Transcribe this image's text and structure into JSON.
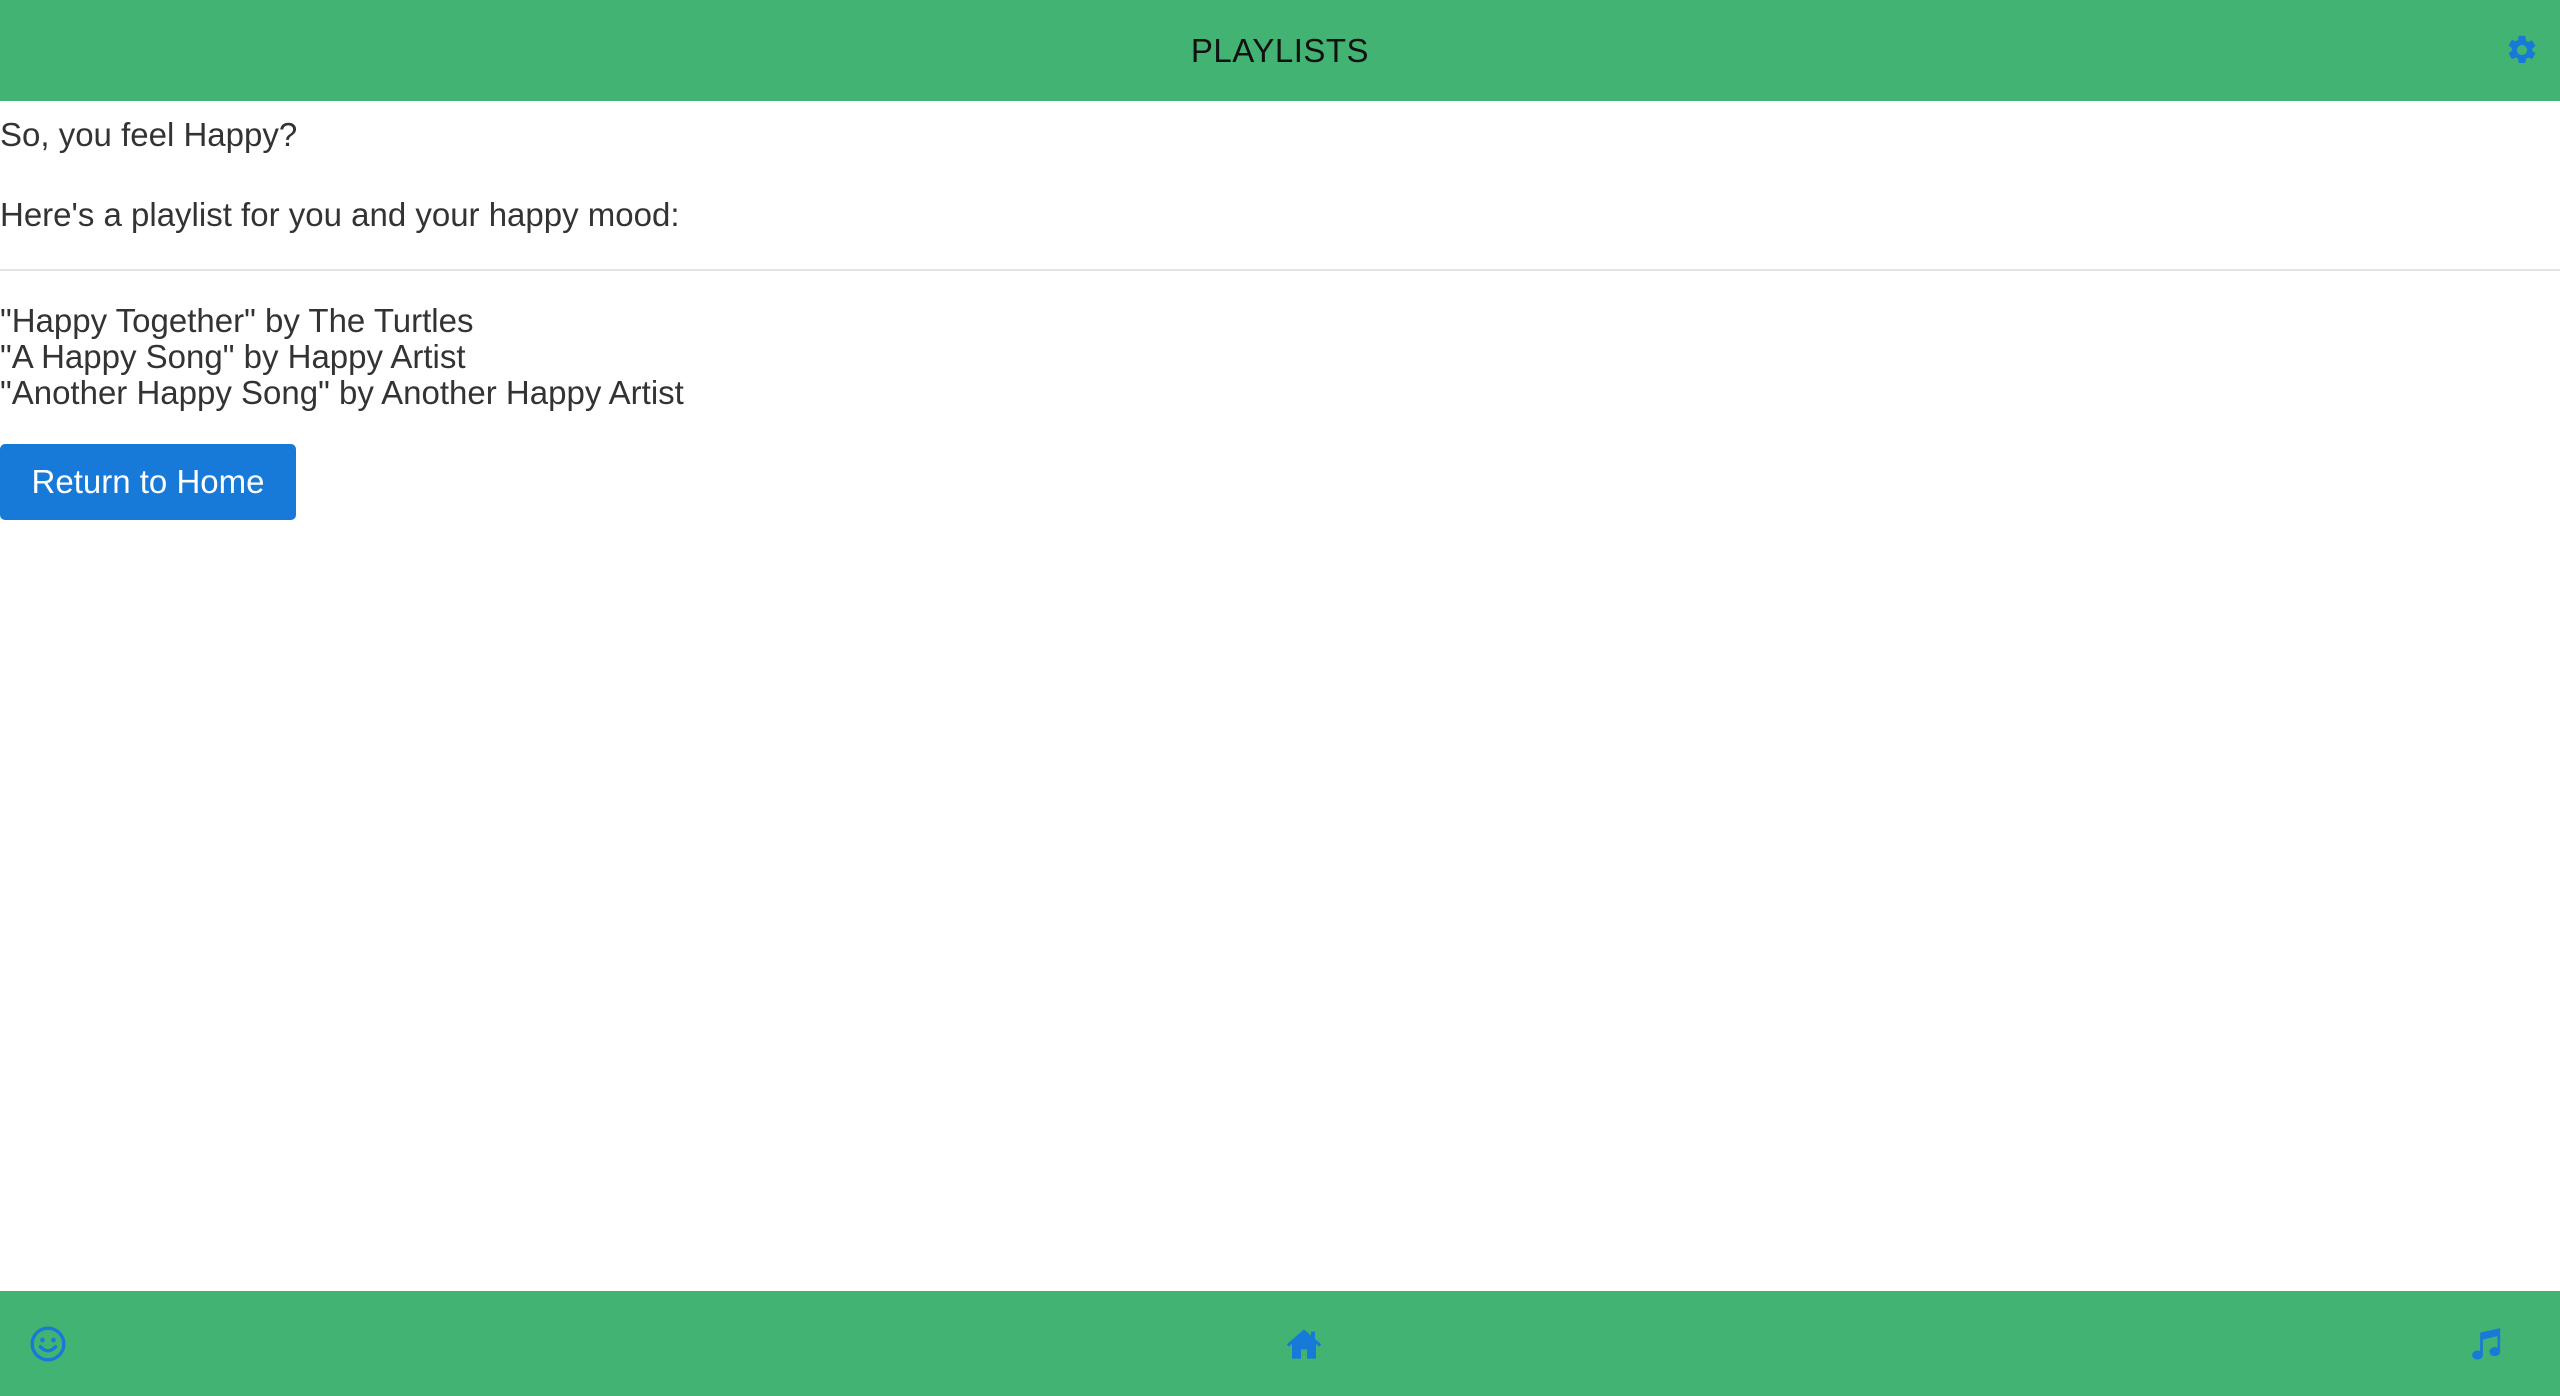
{
  "header": {
    "title": "PLAYLISTS",
    "settings_icon": "gear-icon"
  },
  "main": {
    "question": "So, you feel Happy?",
    "intro": "Here's a playlist for you and your happy mood:",
    "songs": [
      "\"Happy Together\" by The Turtles",
      "\"A Happy Song\" by Happy Artist",
      "\"Another Happy Song\" by Another Happy Artist"
    ],
    "return_button": "Return to Home"
  },
  "footer": {
    "left_icon": "smiley-icon",
    "center_icon": "home-icon",
    "right_icon": "music-note-icon"
  },
  "colors": {
    "bar_green": "#42b373",
    "accent_blue": "#1779d8",
    "text": "#333333"
  }
}
